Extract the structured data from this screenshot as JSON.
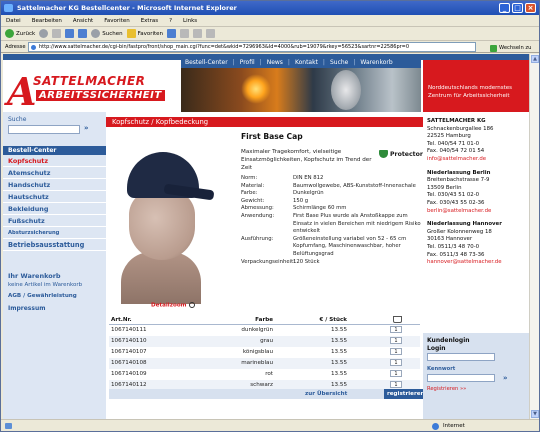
{
  "window": {
    "title": "Sattelmacher KG Bestellcenter - Microsoft Internet Explorer",
    "controls": [
      "_",
      "□",
      "×"
    ]
  },
  "menubar": [
    "Datei",
    "Bearbeiten",
    "Ansicht",
    "Favoriten",
    "Extras",
    "?",
    "Links"
  ],
  "toolbar": {
    "back": "Zurück",
    "search": "Suchen",
    "favorites": "Favoriten"
  },
  "address": {
    "label": "Adresse",
    "url": "http://www.sattelmacher.de/cgi-bin/fastpro/front/shop_main.cgi?func=det&wkid=7296963&Id=4000&rub=19079&rkey=56523&sartnr=22586pr=0",
    "go": "Wechseln zu"
  },
  "status": {
    "zone": "Internet"
  },
  "site": {
    "topnav": [
      "Bestell-Center",
      "Profil",
      "News",
      "Kontakt",
      "Suche",
      "Warenkorb"
    ],
    "logo_line1": "SATTELMACHER",
    "logo_line2": "ARBEITSSICHERHEIT",
    "tagline": "Norddeutschlands modernstes Zentrum für Arbeitssicherheit",
    "search_label": "Suche",
    "search_go": "»",
    "nav_header": "Bestell-Center",
    "nav": [
      {
        "label": "Kopfschutz",
        "active": true
      },
      {
        "label": "Atemschutz",
        "active": false
      },
      {
        "label": "Handschutz",
        "active": false
      },
      {
        "label": "Hautschutz",
        "active": false
      },
      {
        "label": "Bekleidung",
        "active": false
      },
      {
        "label": "Fußschutz",
        "active": false
      },
      {
        "label": "Absturzsicherung",
        "active": false
      },
      {
        "label": "Betriebsausstattung",
        "active": false
      }
    ],
    "cart_title": "Ihr Warenkorb",
    "cart_sub": "keine Artikel im Warenkorb",
    "agb": "AGB / Gewährleistung",
    "impressum": "Impressum",
    "breadcrumb": "Kopfschutz / Kopfbedeckung",
    "product": {
      "title": "First Base Cap",
      "description": "Maximaler Tragekomfort, vielseitige Einsatzmöglichkeiten, Kopfschutz im Trend der Zeit",
      "brand": "Protector",
      "zoom_label": "Detailzoom",
      "specs": [
        {
          "k": "Norm:",
          "v": "DIN EN 812"
        },
        {
          "k": "Material:",
          "v": "Baumwollgewebe, ABS-Kunststoff-Innenschale"
        },
        {
          "k": "Farbe:",
          "v": "Dunkelgrün"
        },
        {
          "k": "Gewicht:",
          "v": "150 g"
        },
        {
          "k": "Abmessung:",
          "v": "Schirmlänge 60 mm"
        },
        {
          "k": "Anwendung:",
          "v": "First Base Plus wurde als Anstoßkappe zum Einsatz in vielen Bereichen mit niedrigem Risiko entwickelt"
        },
        {
          "k": "Ausführung:",
          "v": "Größeneinstellung variabel von 52 - 65 cm Kopfumfang, Maschinenwaschbar, hoher Belüftungsgrad"
        },
        {
          "k": "Verpackungseinheit:",
          "v": "120 Stück"
        }
      ]
    },
    "table": {
      "headers": [
        "Art.Nr.",
        "Farbe",
        "€ / Stück",
        ""
      ],
      "rows": [
        {
          "nr": "1067140111",
          "farbe": "dunkelgrün",
          "preis": "13.55",
          "qty": "1"
        },
        {
          "nr": "1067140110",
          "farbe": "grau",
          "preis": "13.55",
          "qty": "1"
        },
        {
          "nr": "1067140107",
          "farbe": "königsblau",
          "preis": "13.55",
          "qty": "1"
        },
        {
          "nr": "1067140108",
          "farbe": "marineblau",
          "preis": "13.55",
          "qty": "1"
        },
        {
          "nr": "1067140109",
          "farbe": "rot",
          "preis": "13.55",
          "qty": "1"
        },
        {
          "nr": "1067140112",
          "farbe": "schwarz",
          "preis": "13.55",
          "qty": "1"
        }
      ],
      "overview": "zur Übersicht",
      "register": "registrieren"
    },
    "contacts": [
      {
        "head": "SATTELMACHER KG",
        "lines": [
          "Schnackenburgallee 186",
          "22525 Hamburg",
          "Tel. 040/54 71 01-0",
          "Fax. 040/54 72 01 54"
        ],
        "email": "info@sattelmacher.de"
      },
      {
        "head": "Niederlassung Berlin",
        "lines": [
          "Breitenbachstrasse 7-9",
          "13509 Berlin",
          "Tel. 030/43 51 02-0",
          "Fax. 030/43 55 02-36"
        ],
        "email": "berlin@sattelmacher.de"
      },
      {
        "head": "Niederlassung Hannover",
        "lines": [
          "Großer Kolonnenweg 18",
          "30163 Hannover",
          "Tel. 0511/3 48 70-0",
          "Fax. 0511/3 48 73-36"
        ],
        "email": "hannover@sattelmacher.de"
      }
    ],
    "login": {
      "title1": "Kundenlogin",
      "title2": "Login",
      "password_label": "Kennwort",
      "go": "»",
      "register": "Registrieren »»"
    }
  }
}
